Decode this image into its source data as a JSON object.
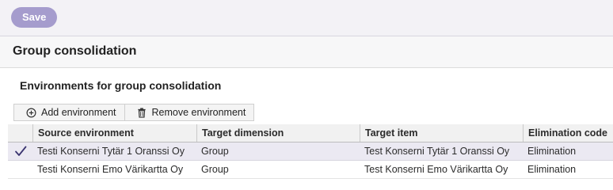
{
  "toolbar": {
    "save_label": "Save"
  },
  "section": {
    "title": "Group consolidation",
    "subtitle": "Environments for group consolidation"
  },
  "actions": {
    "add_label": "Add environment",
    "remove_label": "Remove environment",
    "add_icon": "add-circle-icon",
    "remove_icon": "trash-icon"
  },
  "table": {
    "columns": [
      "Source environment",
      "Target dimension",
      "Target item",
      "Elimination code"
    ],
    "rows": [
      {
        "selected": true,
        "source": "Testi Konserni Tytär 1 Oranssi Oy",
        "dimension": "Group",
        "item": "Test Konserni Tytär 1 Oranssi Oy",
        "elimination": "Elimination"
      },
      {
        "selected": false,
        "source": "Testi Konserni Emo Värikartta Oy",
        "dimension": "Group",
        "item": "Test Konserni Emo Värikartta Oy",
        "elimination": "Elimination"
      }
    ]
  },
  "colors": {
    "save_button": "#a59ccd",
    "selected_row": "#ebe9f2",
    "check": "#3a3470"
  }
}
